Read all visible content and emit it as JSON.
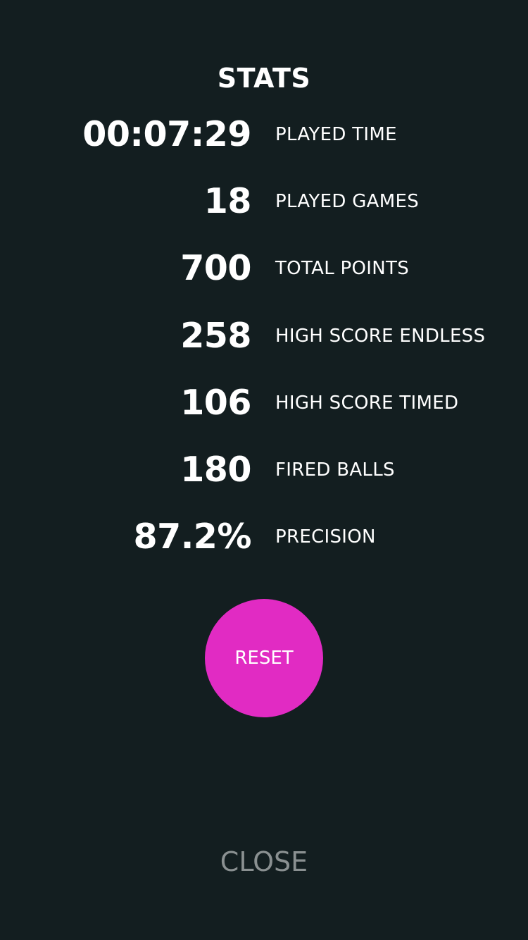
{
  "theme": {
    "background": "#131e20",
    "text": "#ffffff",
    "accent": "#e12bc3",
    "muted": "#8a9091"
  },
  "header": {
    "title": "STATS"
  },
  "stats": [
    {
      "value": "00:07:29",
      "label": "PLAYED TIME"
    },
    {
      "value": "18",
      "label": "PLAYED GAMES"
    },
    {
      "value": "700",
      "label": "TOTAL POINTS"
    },
    {
      "value": "258",
      "label": "HIGH SCORE ENDLESS"
    },
    {
      "value": "106",
      "label": "HIGH SCORE TIMED"
    },
    {
      "value": "180",
      "label": "FIRED BALLS"
    },
    {
      "value": "87.2%",
      "label": "PRECISION"
    }
  ],
  "actions": {
    "reset_label": "RESET",
    "close_label": "CLOSE"
  }
}
